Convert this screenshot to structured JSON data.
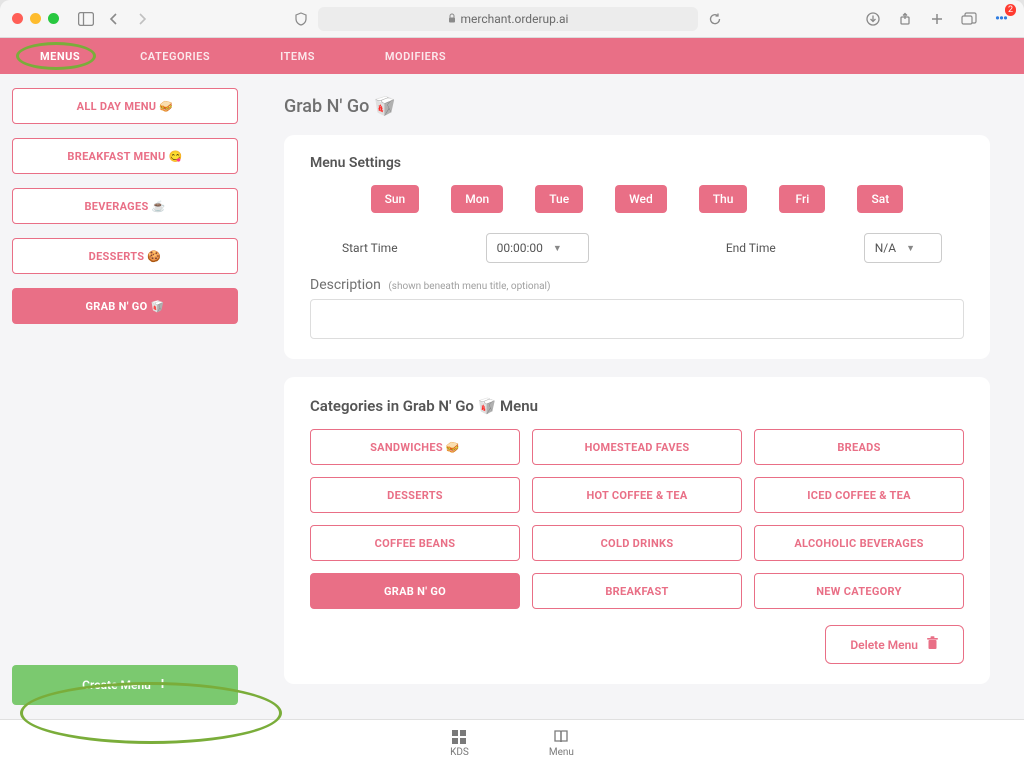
{
  "browser": {
    "url": "merchant.orderup.ai",
    "ext_badge": "2"
  },
  "topnav": {
    "tabs": [
      "MENUS",
      "CATEGORIES",
      "ITEMS",
      "MODIFIERS"
    ],
    "active": "MENUS"
  },
  "sidebar": {
    "menus": [
      {
        "label": "ALL DAY MENU 🥪",
        "active": false
      },
      {
        "label": "BREAKFAST MENU 😋",
        "active": false
      },
      {
        "label": "BEVERAGES ☕",
        "active": false
      },
      {
        "label": "DESSERTS 🍪",
        "active": false
      },
      {
        "label": "GRAB N' GO 🥡",
        "active": true
      }
    ],
    "create_label": "Create Menu"
  },
  "page": {
    "title": "Grab N' Go 🥡"
  },
  "settings": {
    "heading": "Menu Settings",
    "days": [
      "Sun",
      "Mon",
      "Tue",
      "Wed",
      "Thu",
      "Fri",
      "Sat"
    ],
    "start_label": "Start Time",
    "end_label": "End Time",
    "start_value": "00:00:00",
    "end_value": "N/A",
    "desc_label": "Description",
    "desc_hint": "(shown beneath menu title, optional)",
    "desc_value": ""
  },
  "categories_section": {
    "heading": "Categories in Grab N' Go 🥡 Menu",
    "items": [
      {
        "label": "SANDWICHES 🥪",
        "active": false
      },
      {
        "label": "HOMESTEAD FAVES",
        "active": false
      },
      {
        "label": "BREADS",
        "active": false
      },
      {
        "label": "DESSERTS",
        "active": false
      },
      {
        "label": "HOT COFFEE & TEA",
        "active": false
      },
      {
        "label": "ICED COFFEE & TEA",
        "active": false
      },
      {
        "label": "COFFEE BEANS",
        "active": false
      },
      {
        "label": "COLD DRINKS",
        "active": false
      },
      {
        "label": "ALCOHOLIC BEVERAGES",
        "active": false
      },
      {
        "label": "GRAB N' GO",
        "active": true
      },
      {
        "label": "BREAKFAST",
        "active": false
      },
      {
        "label": "NEW CATEGORY",
        "active": false
      }
    ]
  },
  "actions": {
    "delete_label": "Delete Menu"
  },
  "footer": {
    "kds": "KDS",
    "menu": "Menu"
  }
}
